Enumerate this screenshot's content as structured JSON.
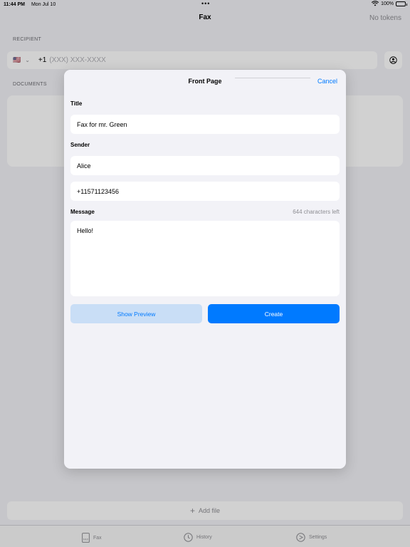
{
  "status_bar": {
    "time": "11:44 PM",
    "date": "Mon Jul 10",
    "battery": "100%"
  },
  "nav": {
    "title": "Fax",
    "right_label": "No tokens"
  },
  "recipient": {
    "section_label": "RECIPIENT",
    "flag": "🇺🇸",
    "country_code": "+1",
    "placeholder": "(XXX) XXX-XXXX"
  },
  "documents": {
    "section_label": "DOCUMENTS"
  },
  "add_file": {
    "label": "Add file"
  },
  "tabs": [
    {
      "label": "Fax"
    },
    {
      "label": "History"
    },
    {
      "label": "Settings"
    }
  ],
  "modal": {
    "title": "Front Page",
    "cancel_label": "Cancel",
    "title_label": "Title",
    "title_value": "Fax for mr. Green",
    "sender_label": "Sender",
    "sender_name": "Alice",
    "sender_phone": "+11571123456",
    "message_label": "Message",
    "chars_left": "644 characters left",
    "message_value": "Hello!",
    "preview_label": "Show Preview",
    "create_label": "Create"
  },
  "colors": {
    "accent": "#007aff",
    "accent_light": "#c9def6",
    "background": "#f2f2f7"
  }
}
